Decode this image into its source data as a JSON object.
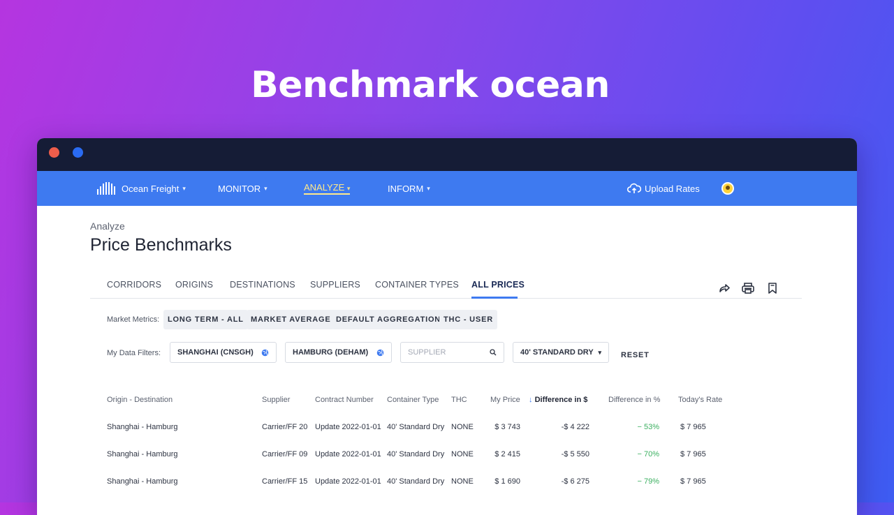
{
  "hero": {
    "title": "Benchmark ocean"
  },
  "navbar": {
    "brand": "Ocean Freight",
    "items": [
      {
        "label": "MONITOR"
      },
      {
        "label": "ANALYZE"
      },
      {
        "label": "INFORM"
      }
    ],
    "upload_label": "Upload Rates",
    "active_color": "#ffe98a"
  },
  "page": {
    "section": "Analyze",
    "title": "Price Benchmarks"
  },
  "tabs": [
    {
      "label": "CORRIDORS"
    },
    {
      "label": "ORIGINS"
    },
    {
      "label": "DESTINATIONS"
    },
    {
      "label": "SUPPLIERS"
    },
    {
      "label": "CONTAINER TYPES"
    },
    {
      "label": "ALL PRICES",
      "active": true
    }
  ],
  "toolbar_icons": [
    "share-icon",
    "print-icon",
    "bookmark-icon"
  ],
  "metrics": {
    "label": "Market Metrics:",
    "chips": [
      "LONG TERM - ALL",
      "MARKET AVERAGE",
      "DEFAULT AGGREGATION",
      "THC - USER"
    ]
  },
  "filters": {
    "label": "My Data Filters:",
    "origin": "SHANGHAI (CNSGH)",
    "destination": "HAMBURG (DEHAM)",
    "supplier_placeholder": "SUPPLIER",
    "container": "40' STANDARD DRY",
    "reset": "RESET"
  },
  "table": {
    "columns": [
      "Origin - Destination",
      "Supplier",
      "Contract Number",
      "Container Type",
      "THC",
      "My Price",
      "Difference in $",
      "Difference in %",
      "Today's Rate"
    ],
    "sorted_column": "Difference in $",
    "rows": [
      [
        "Shanghai - Hamburg",
        "Carrier/FF 20",
        "Update 2022-01-01",
        "40' Standard Dry",
        "NONE",
        "$ 3 743",
        "-$ 4 222",
        "− 53%",
        "$ 7 965"
      ],
      [
        "Shanghai - Hamburg",
        "Carrier/FF 09",
        "Update 2022-01-01",
        "40' Standard Dry",
        "NONE",
        "$ 2 415",
        "-$ 5 550",
        "− 70%",
        "$ 7 965"
      ],
      [
        "Shanghai - Hamburg",
        "Carrier/FF 15",
        "Update 2022-01-01",
        "40' Standard Dry",
        "NONE",
        "$ 1 690",
        "-$ 6 275",
        "− 79%",
        "$ 7 965"
      ]
    ]
  }
}
